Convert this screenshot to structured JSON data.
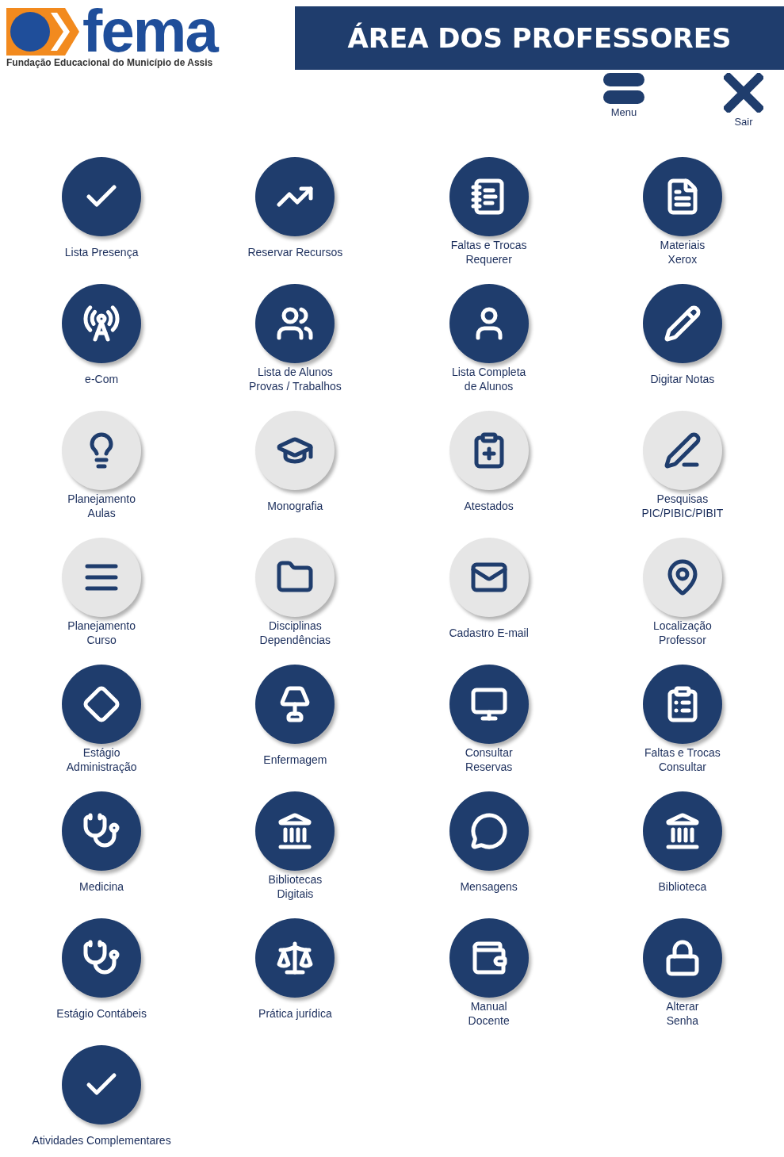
{
  "header": {
    "logo_text": "fema",
    "logo_subtitle": "Fundação Educacional do Município de Assis",
    "title": "ÁREA DOS PROFESSORES"
  },
  "actions": [
    {
      "kind": "menu",
      "label": "Menu"
    },
    {
      "kind": "close",
      "label": "Sair"
    }
  ],
  "tiles": [
    {
      "label": "Lista Presença",
      "kind": "dark"
    },
    {
      "label": "Reservar Recursos",
      "kind": "dark"
    },
    {
      "label": "Faltas e Trocas\nRequerer",
      "kind": "dark"
    },
    {
      "label": "Materiais\nXerox",
      "kind": "dark"
    },
    {
      "label": "e-Com",
      "kind": "dark"
    },
    {
      "label": "Lista de Alunos\nProvas / Trabalhos",
      "kind": "dark"
    },
    {
      "label": "Lista Completa\nde Alunos",
      "kind": "dark"
    },
    {
      "label": "Digitar Notas",
      "kind": "dark"
    },
    {
      "label": "Planejamento\nAulas",
      "kind": "light"
    },
    {
      "label": "Monografia",
      "kind": "light"
    },
    {
      "label": "Atestados",
      "kind": "light"
    },
    {
      "label": "Pesquisas\nPIC/PIBIC/PIBIT",
      "kind": "light"
    },
    {
      "label": "Planejamento\nCurso",
      "kind": "light"
    },
    {
      "label": "Disciplinas\nDependências",
      "kind": "light"
    },
    {
      "label": "Cadastro E-mail",
      "kind": "light"
    },
    {
      "label": "Localização\nProfessor",
      "kind": "light"
    },
    {
      "label": "Estágio\nAdministração",
      "kind": "dark"
    },
    {
      "label": "Enfermagem",
      "kind": "dark"
    },
    {
      "label": "Consultar\nReservas",
      "kind": "dark"
    },
    {
      "label": "Faltas e Trocas\nConsultar",
      "kind": "dark"
    },
    {
      "label": "Medicina",
      "kind": "dark"
    },
    {
      "label": "Bibliotecas\nDigitais",
      "kind": "dark"
    },
    {
      "label": "Mensagens",
      "kind": "dark"
    },
    {
      "label": "Biblioteca",
      "kind": "dark"
    },
    {
      "label": "Estágio Contábeis",
      "kind": "dark"
    },
    {
      "label": "Prática jurídica",
      "kind": "dark"
    },
    {
      "label": "Manual\nDocente",
      "kind": "dark"
    },
    {
      "label": "Alterar\nSenha",
      "kind": "dark"
    },
    {
      "label": "Atividades Complementares",
      "kind": "dark"
    }
  ]
}
